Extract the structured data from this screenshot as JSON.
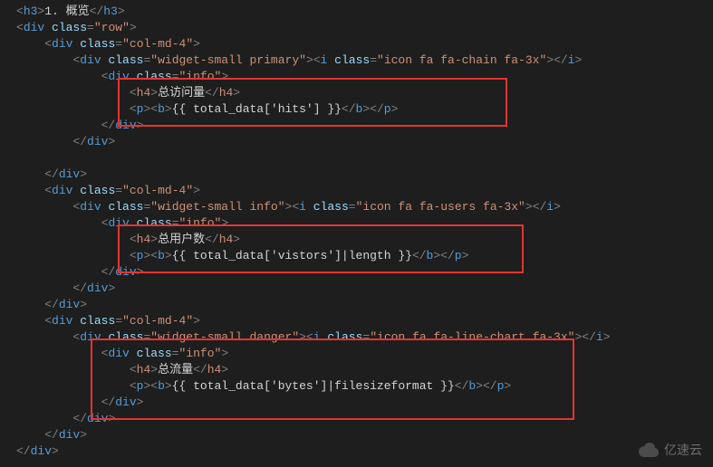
{
  "code": {
    "h3_text": "1. 概览",
    "row_class": "row",
    "col_class": "col-md-4",
    "widget1": {
      "widget_class": "widget-small primary",
      "icon_class": "icon fa fa-chain fa-3x",
      "info_class": "info",
      "h4_text": "总访问量",
      "p_expr": "{{ total_data['hits'] }}"
    },
    "widget2": {
      "widget_class": "widget-small info",
      "icon_class": "icon fa fa-users fa-3x",
      "info_class": "info",
      "h4_text": "总用户数",
      "p_expr": "{{ total_data['vistors']|length }}"
    },
    "widget3": {
      "widget_class": "widget-small danger",
      "icon_class": "icon fa fa-line-chart fa-3x",
      "info_class": "info",
      "h4_text": "总流量",
      "p_expr": "{{ total_data['bytes']|filesizeformat }}"
    }
  },
  "watermark": "亿速云"
}
